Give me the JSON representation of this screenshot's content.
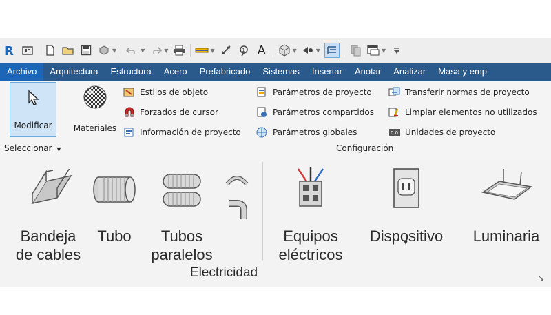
{
  "menubar": {
    "items": [
      "Archivo",
      "Arquitectura",
      "Estructura",
      "Acero",
      "Prefabricado",
      "Sistemas",
      "Insertar",
      "Anotar",
      "Analizar",
      "Masa y emp"
    ],
    "active_color": "#1c66b8",
    "bar_color": "#2a5a8c"
  },
  "quick_access": {
    "icons": [
      "revit-logo-icon",
      "home-icon",
      "new-icon",
      "open-icon",
      "save-icon",
      "sync-icon",
      "undo-icon",
      "redo-icon",
      "print-icon",
      "measure-icon",
      "align-dimension-icon",
      "tag-icon",
      "text-icon",
      "3d-view-icon",
      "section-icon",
      "thin-lines-icon",
      "close-windows-icon",
      "switch-windows-icon",
      "customize-icon"
    ],
    "text_glyph": "A"
  },
  "seleccionar": {
    "modificar_label": "Modificar",
    "panel_label": "Seleccionar"
  },
  "materiales_label": "Materiales",
  "config_col1": [
    "Estilos de objeto",
    "Forzados de cursor",
    "Información de proyecto"
  ],
  "config_col2": [
    "Parámetros de proyecto",
    "Parámetros compartidos",
    "Parámetros  globales"
  ],
  "config_col3": [
    "Transferir normas de proyecto",
    "Limpiar elementos no utilizados",
    "Unidades de proyecto"
  ],
  "configuracion_label": "Configuración",
  "electricidad": {
    "panel_label": "Electricidad",
    "bandeja": [
      "Bandeja",
      "de cables"
    ],
    "tubo": "Tubo",
    "tubos_paralelos": [
      "Tubos",
      "paralelos"
    ],
    "equipos": [
      "Equipos",
      "eléctricos"
    ],
    "dispositivo": "Dispositivo",
    "luminaria": "Luminaria"
  }
}
